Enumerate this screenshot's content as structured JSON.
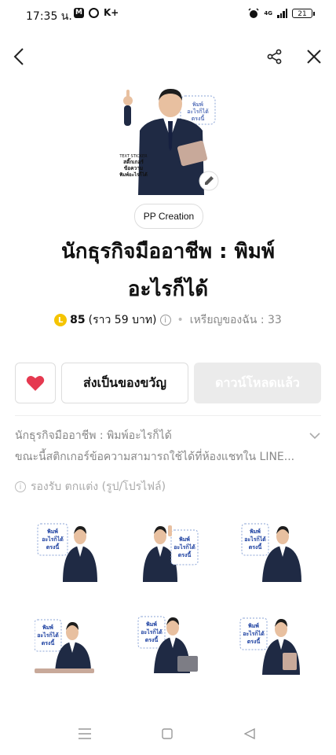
{
  "status": {
    "time": "17:35 น.",
    "left_badge": "M",
    "kplus": "K+",
    "battery": "21",
    "network": "4G"
  },
  "topbar": {
    "back": "chevron-left-icon",
    "share": "share-icon",
    "close": "close-icon"
  },
  "creator": "PP Creation",
  "title_lines": [
    "นักธุรกิจมืออาชีพ : พิมพ์",
    "อะไรก็ได้"
  ],
  "price": {
    "coin_letter": "L",
    "coins": "85",
    "baht": "(ราว 59 บาท)",
    "info": "i",
    "my_coins": "เหรียญของฉัน : 33"
  },
  "actions": {
    "gift": "ส่งเป็นของขวัญ",
    "downloaded": "ดาวน์โหลดแล้ว"
  },
  "description": [
    "นักธุรกิจมืออาชีพ : พิมพ์อะไรก็ได้",
    "ขณะนี้สติกเกอร์ข้อความสามารถใช้ได้ที่ห้องแชทใน LINE..."
  ],
  "support": "รองรับ ตกแต่ง (รูป/โปรไฟล์)",
  "sticker_text": [
    "พิมพ์",
    "อะไรก็ได้",
    "ตรงนี้"
  ],
  "hero_caption": [
    "สติ๊กเกอร์",
    "ข้อความ",
    "พิมพ์อะไรก็ได้"
  ],
  "colors": {
    "suit": "#1f2a44",
    "heart": "#e53950",
    "coin": "#f5c400",
    "sticker_text": "#1b3fa0"
  }
}
